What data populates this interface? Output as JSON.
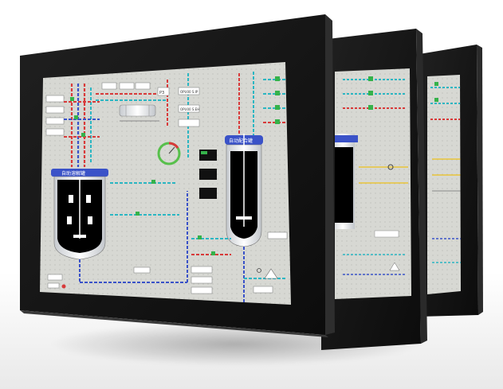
{
  "product": {
    "units": [
      "front-monitor",
      "middle-monitor",
      "back-monitor"
    ],
    "colors": {
      "bezel": "#161616",
      "screen_bg": "#d8d9d4",
      "pipe_red": "#d83a3a",
      "pipe_cyan": "#2bb6c2",
      "pipe_blue": "#3a52c8",
      "valve_green": "#35b24a",
      "tank_body": "#eef0f2",
      "tank_window": "#000000",
      "gauge_ring": "#57c04b",
      "shadow": "#8a8a8a"
    }
  },
  "scada": {
    "tank_left_label": "自助溶解罐",
    "tank_right_label": "自动配合罐",
    "panel_label_1": "P3",
    "panel_label_2": "OPU00 S.IP",
    "panel_label_3": "OPU00 S.EH"
  }
}
